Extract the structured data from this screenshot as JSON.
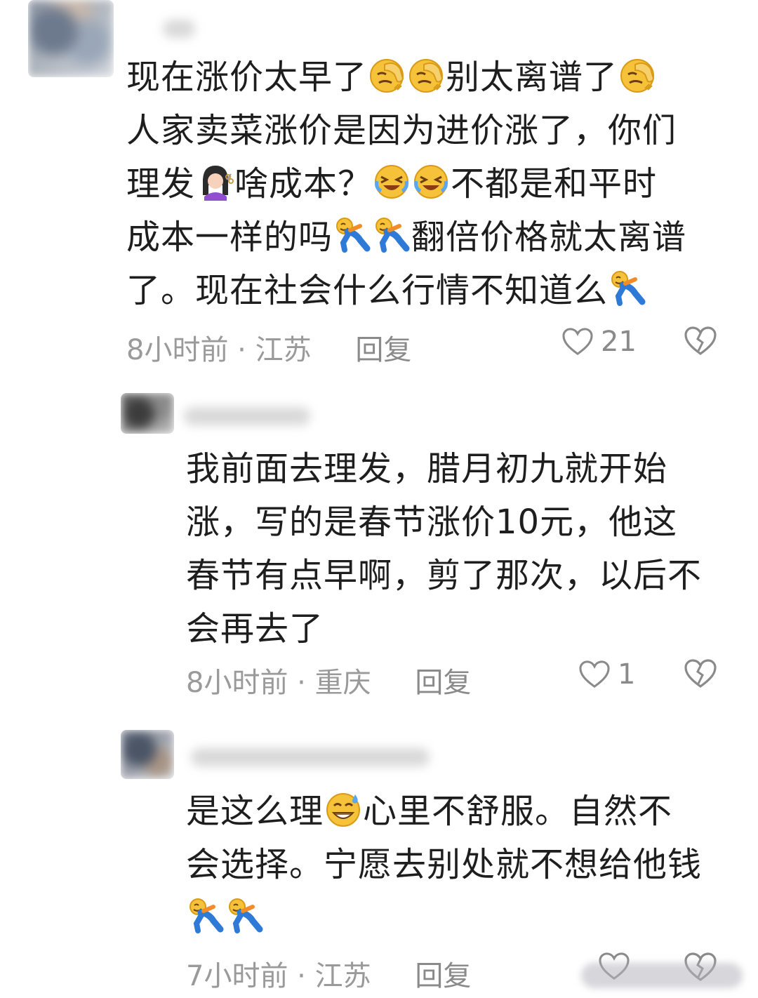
{
  "comments": [
    {
      "lines": [
        [
          "现在涨价太早了",
          "facepalm",
          "facepalm",
          "别太离谱了",
          "facepalm"
        ],
        [
          "人家卖菜涨价是因为进价涨了，你们"
        ],
        [
          "理发",
          "haircut",
          "啥成本？",
          "crying-laugh",
          "crying-laugh",
          "不都是和平时"
        ],
        [
          "成本一样的吗",
          "rolling-floor",
          "rolling-floor",
          "翻倍价格就太离谱"
        ],
        [
          "了。现在社会什么行情不知道么",
          "rolling-floor"
        ]
      ],
      "time": "8小时前",
      "location": "江苏",
      "reply_label": "回复",
      "likes": "21"
    },
    {
      "lines": [
        [
          "我前面去理发，腊月初九就开始"
        ],
        [
          "涨，写的是春节涨价10元，他这"
        ],
        [
          "春节有点早啊，剪了那次，以后不"
        ],
        [
          "会再去了"
        ]
      ],
      "time": "8小时前",
      "location": "重庆",
      "reply_label": "回复",
      "likes": "1"
    },
    {
      "lines": [
        [
          "是这么理",
          "grin-sweat",
          "心里不舒服。自然不"
        ],
        [
          "会选择。宁愿去别处就不想给他钱"
        ],
        [
          "rolling-floor",
          "rolling-floor"
        ]
      ],
      "time": "7小时前",
      "location": "江苏",
      "reply_label": "回复",
      "likes": ""
    }
  ],
  "colors": {
    "text": "#1e1e1e",
    "meta": "#9a9a9a",
    "emoji_yellow": "#f5c23a"
  },
  "icons": {
    "like": "heart-outline-icon",
    "dislike": "broken-heart-icon"
  }
}
